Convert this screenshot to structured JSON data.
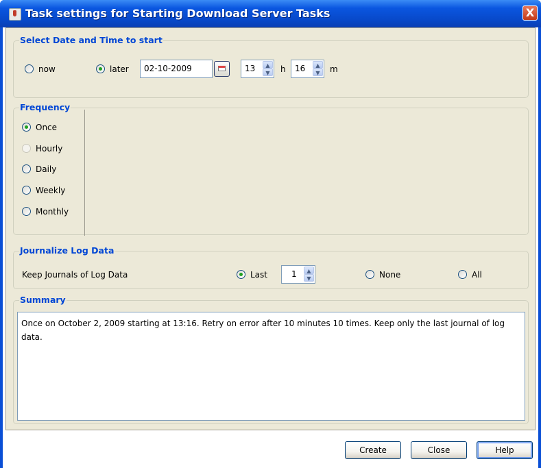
{
  "window": {
    "title": "Task settings for Starting Download Server Tasks",
    "close_symbol": "X"
  },
  "start": {
    "legend": "Select Date and Time  to start",
    "now_label": "now",
    "later_label": "later",
    "selected": "later",
    "date_value": "02-10-2009",
    "hour_value": "13",
    "hour_unit": "h",
    "minute_value": "16",
    "minute_unit": "m"
  },
  "frequency": {
    "legend": "Frequency",
    "options": [
      "Once",
      "Hourly",
      "Daily",
      "Weekly",
      "Monthly"
    ],
    "selected": "Once",
    "disabled": [
      "Hourly"
    ]
  },
  "journal": {
    "legend": "Journalize Log Data",
    "keep_label": "Keep Journals of Log Data",
    "last_label": "Last",
    "last_value": "1",
    "none_label": "None",
    "all_label": "All",
    "selected": "Last"
  },
  "summary": {
    "legend": "Summary",
    "text": "Once on October 2, 2009 starting at 13:16. Retry on error after 10 minutes 10 times. Keep only the last journal of log data."
  },
  "buttons": {
    "create": "Create",
    "close": "Close",
    "help": "Help"
  },
  "colors": {
    "title_bar": "#0a56e0",
    "legend_text": "#0046d5",
    "dialog_bg": "#ece9d8",
    "radio_dot": "#21a121"
  }
}
